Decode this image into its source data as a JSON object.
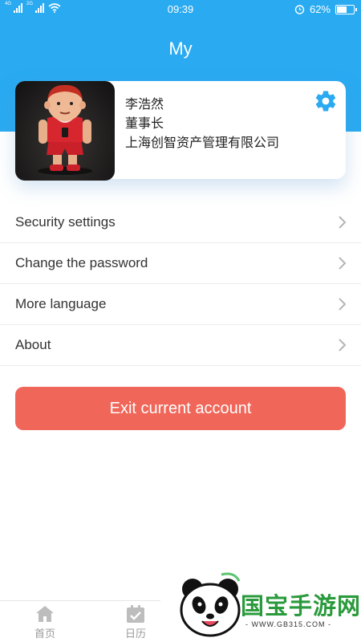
{
  "status_bar": {
    "sim1_tag": "4G",
    "sim2_tag": "2G",
    "time": "09:39",
    "battery_text": "62%",
    "battery_level": 0.62
  },
  "header": {
    "title": "My"
  },
  "profile": {
    "name": "李浩然",
    "position": "董事长",
    "company": "上海创智资产管理有限公司"
  },
  "menu": {
    "items": [
      {
        "label": "Security settings"
      },
      {
        "label": "Change the password"
      },
      {
        "label": "More language"
      },
      {
        "label": "About"
      }
    ]
  },
  "exit_button": {
    "label": "Exit current account"
  },
  "tabbar": {
    "tabs": [
      {
        "label": "首页",
        "icon": "home-icon"
      },
      {
        "label": "日历",
        "icon": "calendar-icon"
      }
    ]
  },
  "watermark": {
    "title": "国宝手游网",
    "url": "- WWW.GB315.COM -"
  },
  "colors": {
    "primary": "#29aaf1",
    "exit": "#f06659",
    "watermark_green": "#2a9a3c"
  }
}
